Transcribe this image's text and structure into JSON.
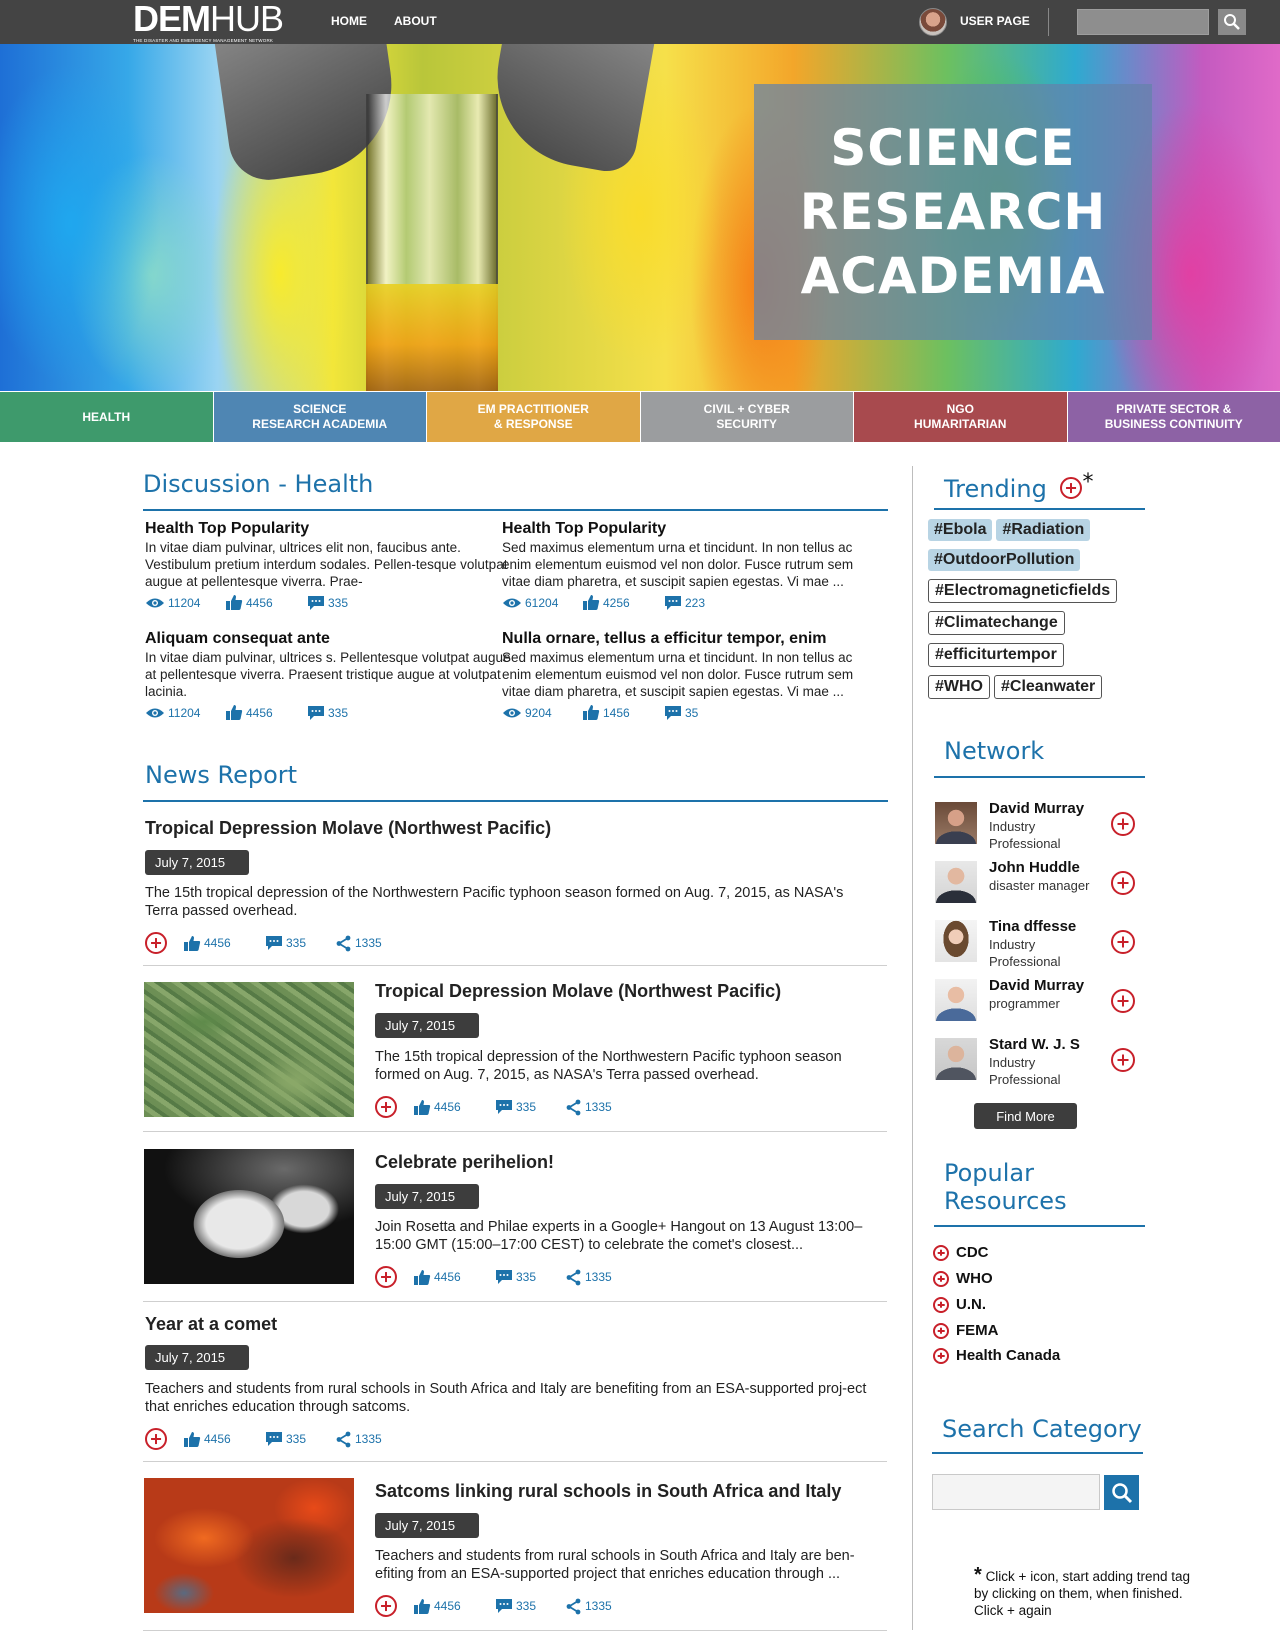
{
  "topbar": {
    "logo_main": "DEM",
    "logo_light": "HUB",
    "logo_tagline": "THE DISASTER AND EMERGENCY MANAGEMENT NETWORK",
    "nav": [
      {
        "label": "HOME"
      },
      {
        "label": "ABOUT"
      }
    ],
    "user_label": "USER PAGE",
    "search_placeholder": ""
  },
  "hero": {
    "lines": [
      "SCIENCE",
      "RESEARCH",
      "ACADEMIA"
    ]
  },
  "categories": [
    {
      "label": "HEALTH",
      "color": "#3e9a6c"
    },
    {
      "label": "SCIENCE\nRESEARCH ACADEMIA",
      "color": "#4f86b3"
    },
    {
      "label": "EM PRACTITIONER\n& RESPONSE",
      "color": "#e0a745"
    },
    {
      "label": "CIVIL + CYBER\nSECURITY",
      "color": "#9b9d9f"
    },
    {
      "label": "NGO\nHUMARITARIAN",
      "color": "#a84a4e"
    },
    {
      "label": "PRIVATE SECTOR &\nBUSINESS CONTINUITY",
      "color": "#8d62a5"
    }
  ],
  "discussion": {
    "title": "Discussion - Health",
    "items": [
      {
        "title": "Health Top Popularity",
        "text": "In vitae diam pulvinar, ultrices elit non, faucibus ante. Vestibulum pretium interdum sodales. Pellen-tesque volutpat augue at pellentesque viverra. Prae-",
        "views": "11204",
        "likes": "4456",
        "comments": "335"
      },
      {
        "title": "Health Top Popularity",
        "text": "Sed maximus elementum urna et tincidunt. In non tellus ac enim elementum euismod vel non dolor. Fusce rutrum sem vitae diam pharetra, et suscipit sapien egestas. Vi mae ...",
        "views": "61204",
        "likes": "4256",
        "comments": "223"
      },
      {
        "title": "Aliquam consequat ante",
        "text": "In vitae diam pulvinar, ultrices s. Pellentesque volutpat augue at pellentesque viverra. Praesent tristique augue at volutpat lacinia.",
        "views": "11204",
        "likes": "4456",
        "comments": "335"
      },
      {
        "title": "Nulla ornare, tellus a efficitur tempor, enim",
        "text": "Sed maximus elementum urna et tincidunt. In non tellus ac enim elementum euismod vel non dolor. Fusce rutrum sem vitae diam pharetra, et suscipit sapien egestas. Vi mae ...",
        "views": "9204",
        "likes": "1456",
        "comments": "35"
      }
    ]
  },
  "news": {
    "title": "News Report",
    "items": [
      {
        "title": "Tropical Depression Molave (Northwest Pacific)",
        "date": "July 7, 2015",
        "text": "The 15th tropical depression of the Northwestern Pacific typhoon season formed on Aug. 7, 2015, as NASA's Terra passed overhead.",
        "likes": "4456",
        "comments": "335",
        "shares": "1335",
        "image": "none"
      },
      {
        "title": "Tropical Depression Molave (Northwest Pacific)",
        "date": "July 7, 2015",
        "text": "The 15th tropical depression of the Northwestern Pacific typhoon season formed on Aug. 7, 2015, as NASA's Terra passed overhead.",
        "likes": "4456",
        "comments": "335",
        "shares": "1335",
        "image": "satellite-farmland"
      },
      {
        "title": "Celebrate perihelion!",
        "date": "July 7, 2015",
        "text": "Join Rosetta and Philae experts in a Google+ Hangout on 13 August 13:00–15:00 GMT (15:00–17:00 CEST) to celebrate the comet's closest...",
        "likes": "4456",
        "comments": "335",
        "shares": "1335",
        "image": "comet"
      },
      {
        "title": "Year at a comet",
        "date": "July 7, 2015",
        "text": "Teachers and students from rural schools in South Africa and Italy are benefiting from an ESA-supported proj-ect that enriches education through satcoms.",
        "likes": "4456",
        "comments": "335",
        "shares": "1335",
        "image": "none"
      },
      {
        "title": "Satcoms linking rural schools in South Africa and Italy",
        "date": "July 7, 2015",
        "text": "Teachers and students from rural schools in South Africa and Italy are ben-efiting from an ESA-supported project that enriches education through ...",
        "likes": "4456",
        "comments": "335",
        "shares": "1335",
        "image": "red-terrain"
      }
    ]
  },
  "trending": {
    "title": "Trending",
    "asterisk": "*",
    "tags": [
      {
        "label": "#Ebola",
        "style": "highlighted"
      },
      {
        "label": "#Radiation",
        "style": "highlighted"
      },
      {
        "label": "#OutdoorPollution",
        "style": "highlighted"
      },
      {
        "label": "#Electromagneticfields",
        "style": "outlined"
      },
      {
        "label": "#Climatechange",
        "style": "outlined"
      },
      {
        "label": "#efficiturtempor",
        "style": "outlined"
      },
      {
        "label": "#WHO",
        "style": "outlined"
      },
      {
        "label": "#Cleanwater",
        "style": "outlined"
      }
    ]
  },
  "network": {
    "title": "Network",
    "people": [
      {
        "name": "David Murray",
        "role": "Industry Professional"
      },
      {
        "name": "John Huddle",
        "role": "disaster manager"
      },
      {
        "name": "Tina dffesse",
        "role": "Industry Professional"
      },
      {
        "name": "David Murray",
        "role": "programmer"
      },
      {
        "name": "Stard W. J. S",
        "role": "Industry Professional"
      }
    ],
    "find_more": "Find More"
  },
  "resources": {
    "title_line1": "Popular",
    "title_line2": "Resources",
    "items": [
      {
        "label": "CDC"
      },
      {
        "label": "WHO"
      },
      {
        "label": "U.N."
      },
      {
        "label": "FEMA"
      },
      {
        "label": "Health Canada"
      }
    ]
  },
  "search_category": {
    "title": "Search Category",
    "placeholder": ""
  },
  "footnote": {
    "star": "*",
    "text": "Click + icon, start adding trend tag by clicking on them, when finished. Click + again"
  },
  "colors": {
    "accent": "#1d72aa",
    "add_red": "#c8202a",
    "topbar": "#444444",
    "badge": "#3d3d3d"
  },
  "icons": [
    "search-icon",
    "eye-icon",
    "thumbs-up-icon",
    "comment-icon",
    "share-icon",
    "plus-circle-icon"
  ]
}
